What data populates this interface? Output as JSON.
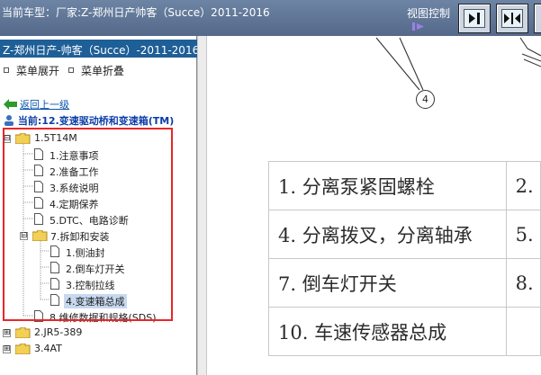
{
  "header": {
    "title": "当前车型：厂家:Z-郑州日产帅客（Succe）2011-2016",
    "view_control_label": "视图控制",
    "buttons": [
      "show-right-pane",
      "split-view",
      "more"
    ]
  },
  "sidebar": {
    "title": "Z-郑州日产-帅客（Succe）-2011-2016-",
    "expand_label": "菜单展开",
    "collapse_label": "菜单折叠",
    "back_label": "返回上一级",
    "current_label": "当前:12.变速驱动桥和变速箱(TM)",
    "tree": [
      {
        "label": "1.5T14M",
        "expander": "⊟"
      },
      {
        "label": "1.注意事项"
      },
      {
        "label": "2.准备工作"
      },
      {
        "label": "3.系统说明"
      },
      {
        "label": "4.定期保养"
      },
      {
        "label": "5.DTC、电路诊断"
      },
      {
        "label": "7.拆卸和安装",
        "expander": "⊟"
      },
      {
        "label": "1.侧油封"
      },
      {
        "label": "2.倒车灯开关"
      },
      {
        "label": "3.控制拉线"
      },
      {
        "label": "4.变速箱总成"
      },
      {
        "label": "8.维修数据和规格(SDS)"
      },
      {
        "label": "2.JR5-389",
        "expander": "⊞"
      },
      {
        "label": "3.4AT",
        "expander": "⊞"
      }
    ]
  },
  "diagram": {
    "callout_label": "4"
  },
  "parts_table": {
    "rows": [
      [
        "1. 分离泵紧固螺栓",
        "2."
      ],
      [
        "4. 分离拨叉，分离轴承",
        "5."
      ],
      [
        "7. 倒车灯开关",
        "8."
      ],
      [
        "10. 车速传感器总成",
        ""
      ]
    ]
  },
  "colors": {
    "header_bg": "#6d84a4",
    "pane_title_bg": "#1e5f97",
    "highlight_border": "#e8262a",
    "selected_bg": "#c7d8ef",
    "link": "#0a54ad"
  }
}
